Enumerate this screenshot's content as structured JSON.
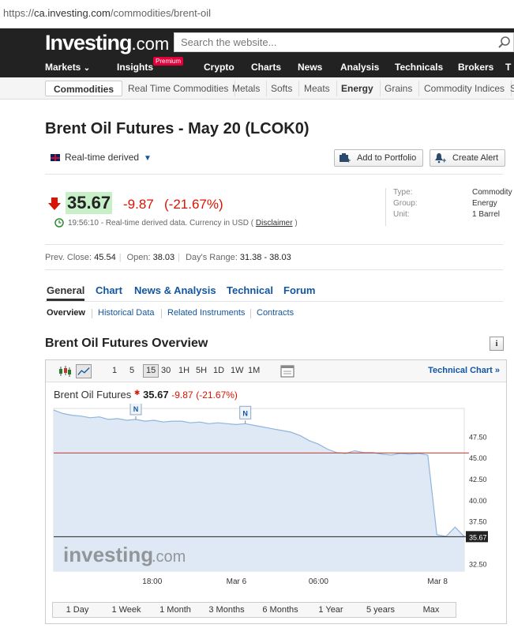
{
  "browser": {
    "url_prefix": "https://",
    "url_host": "ca.investing.com",
    "url_path": "/commodities/brent-oil"
  },
  "header": {
    "logo_main": "Investing",
    "logo_suffix": ".com",
    "search_placeholder": "Search the website..."
  },
  "main_nav": {
    "items": [
      "Markets",
      "Insights",
      "Crypto",
      "Charts",
      "News",
      "Analysis",
      "Technicals",
      "Brokers",
      "T"
    ],
    "markets_caret": "⌄",
    "premium_badge": "Premium"
  },
  "sub_nav": {
    "items": [
      "Commodities",
      "Real Time Commodities",
      "Metals",
      "Softs",
      "Meats",
      "Energy",
      "Grains",
      "Commodity Indices",
      "S"
    ]
  },
  "instrument": {
    "title": "Brent Oil Futures - May 20 (LCOK0)",
    "realtime_label": "Real-time derived",
    "price": "35.67",
    "change": "-9.87",
    "change_pct": "(-21.67%)",
    "time": "19:56:10",
    "time_note": "- Real-time derived data. Currency in USD (",
    "disclaimer": "Disclaimer",
    "time_note_end": ")",
    "add_portfolio": "Add to Portfolio",
    "create_alert": "Create Alert",
    "meta": [
      {
        "k": "Type:",
        "v": "Commodity"
      },
      {
        "k": "Group:",
        "v": "Energy"
      },
      {
        "k": "Unit:",
        "v": "1 Barrel"
      }
    ],
    "prev_close_label": "Prev. Close:",
    "prev_close": "45.54",
    "open_label": "Open:",
    "open": "38.03",
    "range_label": "Day's Range:",
    "range": "31.38 - 38.03"
  },
  "tabs": [
    "General",
    "Chart",
    "News & Analysis",
    "Technical",
    "Forum"
  ],
  "subtabs": [
    "Overview",
    "Historical Data",
    "Related Instruments",
    "Contracts"
  ],
  "overview": {
    "title": "Brent Oil Futures Overview",
    "info_glyph": "i",
    "timeframes": [
      "1",
      "5",
      "15",
      "30",
      "1H",
      "5H",
      "1D",
      "1W",
      "1M"
    ],
    "active_timeframe": "15",
    "technical_chart": "Technical Chart »",
    "chart_label_name": "Brent Oil Futures",
    "chart_label_price": "35.67",
    "chart_label_change": "-9.87",
    "chart_label_pct": "(-21.67%)",
    "ranges": [
      "1 Day",
      "1 Week",
      "1 Month",
      "3 Months",
      "6 Months",
      "1 Year",
      "5 years",
      "Max"
    ]
  },
  "chart_data": {
    "type": "area",
    "title": "",
    "x_tick_labels": [
      "18:00",
      "Mar 6",
      "06:00",
      "Mar 8"
    ],
    "y_tick_labels": [
      "47.50",
      "45.00",
      "42.50",
      "40.00",
      "37.50",
      "35.67",
      "32.50"
    ],
    "ylim": [
      31.6,
      50.8
    ],
    "reference_lines": [
      {
        "value": 45.54,
        "color": "#c0392b"
      },
      {
        "value": 35.67,
        "color": "#222222"
      }
    ],
    "current_value": 35.67,
    "news_markers": [
      "N",
      "N"
    ],
    "watermark_main": "investing",
    "watermark_suffix": ".com",
    "series": [
      {
        "values": [
          50.6,
          50.2,
          50.0,
          49.9,
          49.7,
          49.8,
          49.5,
          49.6,
          49.4,
          49.5,
          49.3,
          49.4,
          49.2,
          49.3,
          49.3,
          49.1,
          49.2,
          49.0,
          49.1,
          49.0,
          48.9,
          49.0,
          48.8,
          48.6,
          48.4,
          48.2,
          48.0,
          47.6,
          47.0,
          46.6,
          46.0,
          45.6,
          45.5,
          45.8,
          45.6,
          45.6,
          45.4,
          45.3,
          45.5,
          45.4,
          45.5,
          45.3,
          35.9,
          35.7,
          36.8,
          35.67
        ]
      }
    ]
  },
  "colors": {
    "accent_blue": "#1256a0",
    "loss_red": "#d91400",
    "price_bg": "#c8f0c8",
    "chart_fill": "#dfe9f5",
    "chart_line": "#8fb5dc"
  }
}
